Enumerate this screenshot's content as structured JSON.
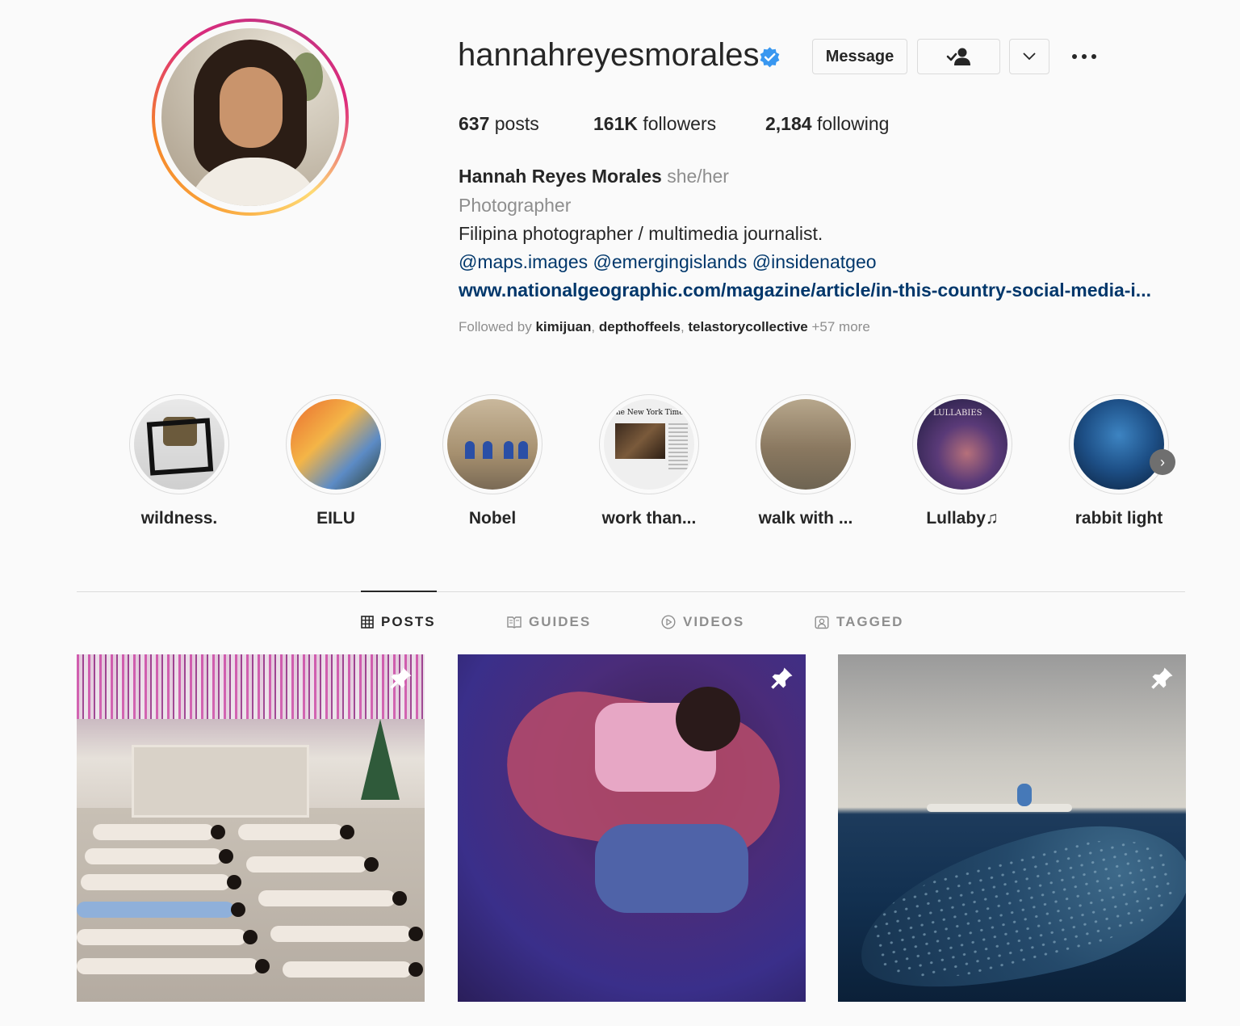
{
  "profile": {
    "username": "hannahreyesmorales",
    "verified_icon": "verified-badge-icon",
    "buttons": {
      "message": "Message",
      "follow_icon": "following-person-check-icon",
      "dropdown_icon": "chevron-down-icon",
      "more_icon": "more-dots-icon"
    },
    "stats": {
      "posts_count": "637",
      "posts_label": "posts",
      "followers_count": "161K",
      "followers_label": "followers",
      "following_count": "2,184",
      "following_label": "following"
    },
    "bio": {
      "full_name": "Hannah Reyes Morales",
      "pronouns": "she/her",
      "category": "Photographer",
      "description": "Filipina photographer / multimedia journalist.",
      "mentions": "@maps.images @emergingislands @insidenatgeo",
      "link": "www.nationalgeographic.com/magazine/article/in-this-country-social-media-i..."
    },
    "followed_by": {
      "prefix": "Followed by",
      "users": [
        "kimijuan",
        "depthoffeels",
        "telastorycollective"
      ],
      "more": "+57 more"
    }
  },
  "highlights": [
    {
      "label": "wildness."
    },
    {
      "label": "EILU"
    },
    {
      "label": "Nobel"
    },
    {
      "label": "work than..."
    },
    {
      "label": "walk with ..."
    },
    {
      "label": "Lullaby♫"
    },
    {
      "label": "rabbit light"
    }
  ],
  "highlight_texts": {
    "newspaper_masthead": "The New York Times",
    "lullabies_title": "LULLABIES"
  },
  "tabs": [
    {
      "label": "POSTS",
      "icon": "grid-icon",
      "active": true
    },
    {
      "label": "GUIDES",
      "icon": "guide-book-icon",
      "active": false
    },
    {
      "label": "VIDEOS",
      "icon": "play-circle-icon",
      "active": false
    },
    {
      "label": "TAGGED",
      "icon": "tagged-person-icon",
      "active": false
    }
  ],
  "posts": [
    {
      "pinned": true,
      "pin_icon": "pin-icon"
    },
    {
      "pinned": true,
      "pin_icon": "pin-icon"
    },
    {
      "pinned": true,
      "pin_icon": "pin-icon"
    }
  ],
  "colors": {
    "link": "#00376b",
    "secondary_text": "#8e8e8e",
    "verified": "#3897f0",
    "border": "#dbdbdb"
  }
}
